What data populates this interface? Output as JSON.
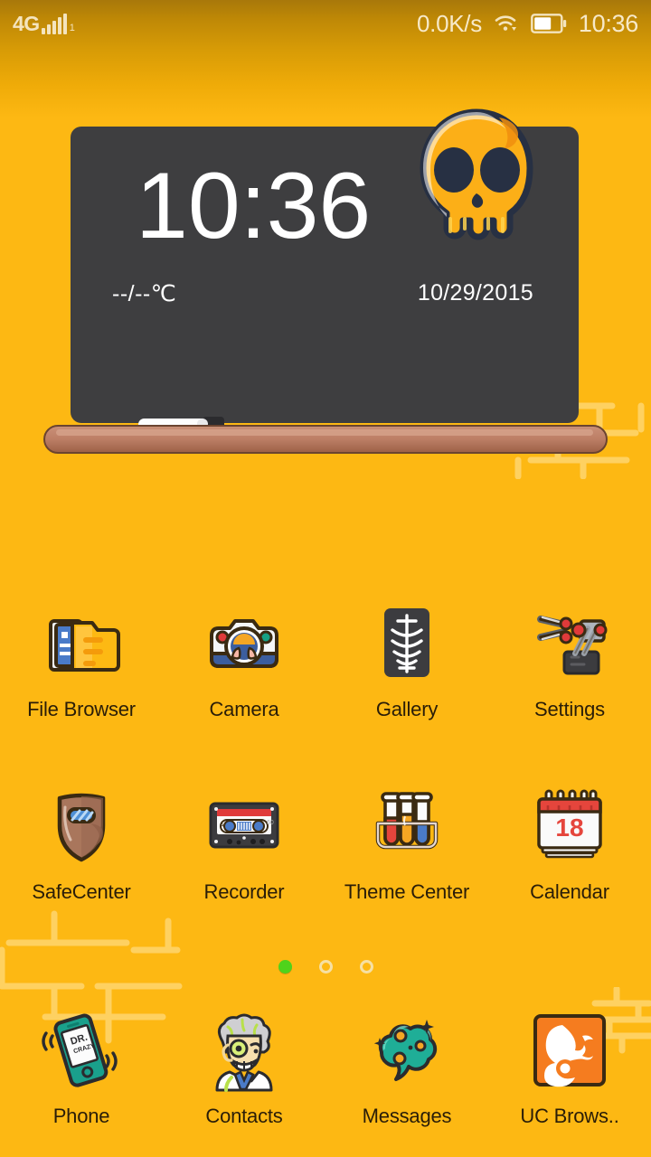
{
  "status_bar": {
    "network_type": "4G",
    "sim_index": "1",
    "signal_icon": "signal-bars-icon",
    "net_speed": "0.0K/s",
    "wifi_icon": "wifi-icon",
    "battery_icon": "battery-icon",
    "battery_level_percent": 60,
    "time": "10:36"
  },
  "clock_widget": {
    "name": "chalkboard-clock-widget",
    "time": "10:36",
    "temperature": "--/--℃",
    "date": "10/29/2015",
    "skull_icon": "skull-icon",
    "chalk_icon": "chalk-icon",
    "eraser_icon": "eraser-icon",
    "board_color": "#3E3E40",
    "tray_color": "#BD7F66"
  },
  "wallpaper": {
    "background_color": "#FDB813",
    "pattern": "brick-wall-outline",
    "pattern_color": "#FFD366",
    "status_shade_top_color": "#A8780A"
  },
  "app_grid": {
    "rows": [
      [
        {
          "label": "File Browser",
          "icon": "file-browser-icon"
        },
        {
          "label": "Camera",
          "icon": "camera-icon"
        },
        {
          "label": "Gallery",
          "icon": "gallery-xray-icon"
        },
        {
          "label": "Settings",
          "icon": "settings-robot-arm-icon"
        }
      ],
      [
        {
          "label": "SafeCenter",
          "icon": "safecenter-welding-mask-icon"
        },
        {
          "label": "Recorder",
          "icon": "recorder-cassette-icon"
        },
        {
          "label": "Theme Center",
          "icon": "theme-center-test-tubes-icon"
        },
        {
          "label": "Calendar",
          "icon": "calendar-icon",
          "day": "18"
        }
      ]
    ]
  },
  "page_indicator": {
    "total": 3,
    "active_index": 0,
    "active_color": "#4FD31B",
    "inactive_color": "#F6E0A4"
  },
  "dock": {
    "items": [
      {
        "label": "Phone",
        "icon": "phone-icon",
        "screen_text_line1": "DR.",
        "screen_text_line2": "CRAZY"
      },
      {
        "label": "Contacts",
        "icon": "contacts-scientist-icon"
      },
      {
        "label": "Messages",
        "icon": "messages-cloud-icon"
      },
      {
        "label": "UC Brows..",
        "icon": "uc-browser-squirrel-icon"
      }
    ]
  }
}
